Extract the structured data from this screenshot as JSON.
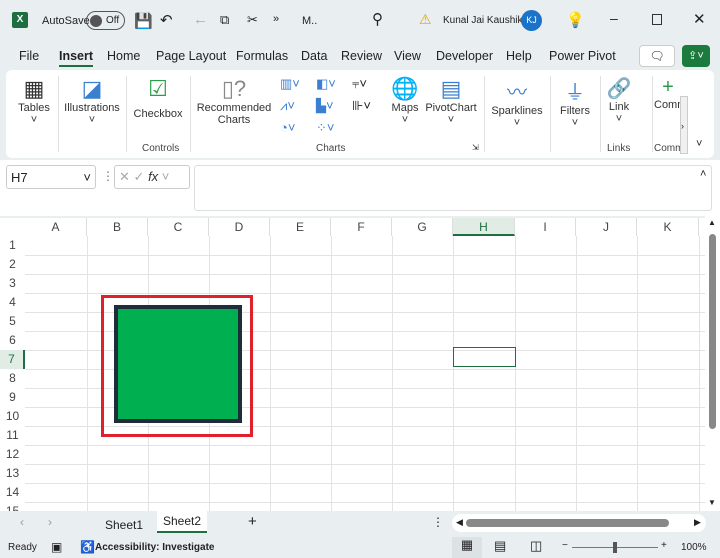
{
  "titlebar": {
    "app_icon": "excel-icon",
    "autosave_label": "AutoSave",
    "autosave_state": "Off",
    "filename": "M..",
    "user": "Kunal Jai Kaushik",
    "initials": "KJ"
  },
  "tabs": [
    "File",
    "Insert",
    "Home",
    "Page Layout",
    "Formulas",
    "Data",
    "Review",
    "View",
    "Developer",
    "Help",
    "Power Pivot"
  ],
  "active_tab": "Insert",
  "ribbon": {
    "tables": "Tables",
    "illustrations": "Illustrations",
    "checkbox": "Checkbox",
    "controls_group": "Controls",
    "recommended": "Recommended",
    "charts_word": "Charts",
    "charts_group": "Charts",
    "maps": "Maps",
    "pivotchart": "PivotChart",
    "sparklines": "Sparklines",
    "filters": "Filters",
    "link": "Link",
    "links_group": "Links",
    "comment": "Comm",
    "comments_group": "Comm"
  },
  "formula": {
    "name_box": "H7",
    "fx": "fx",
    "value": ""
  },
  "columns": [
    "A",
    "B",
    "C",
    "D",
    "E",
    "F",
    "G",
    "H",
    "I",
    "J",
    "K"
  ],
  "rows": [
    "1",
    "2",
    "3",
    "4",
    "5",
    "6",
    "7",
    "8",
    "9",
    "10",
    "11",
    "12",
    "13",
    "14",
    "15"
  ],
  "selected_cell": "H7",
  "shape": {
    "fill": "#00b050",
    "border": "#1f2d3a",
    "highlight": "#e0202a"
  },
  "sheets": [
    "Sheet1",
    "Sheet2"
  ],
  "active_sheet": "Sheet2",
  "status": {
    "ready": "Ready",
    "accessibility": "Accessibility: Investigate",
    "zoom": "100%"
  }
}
